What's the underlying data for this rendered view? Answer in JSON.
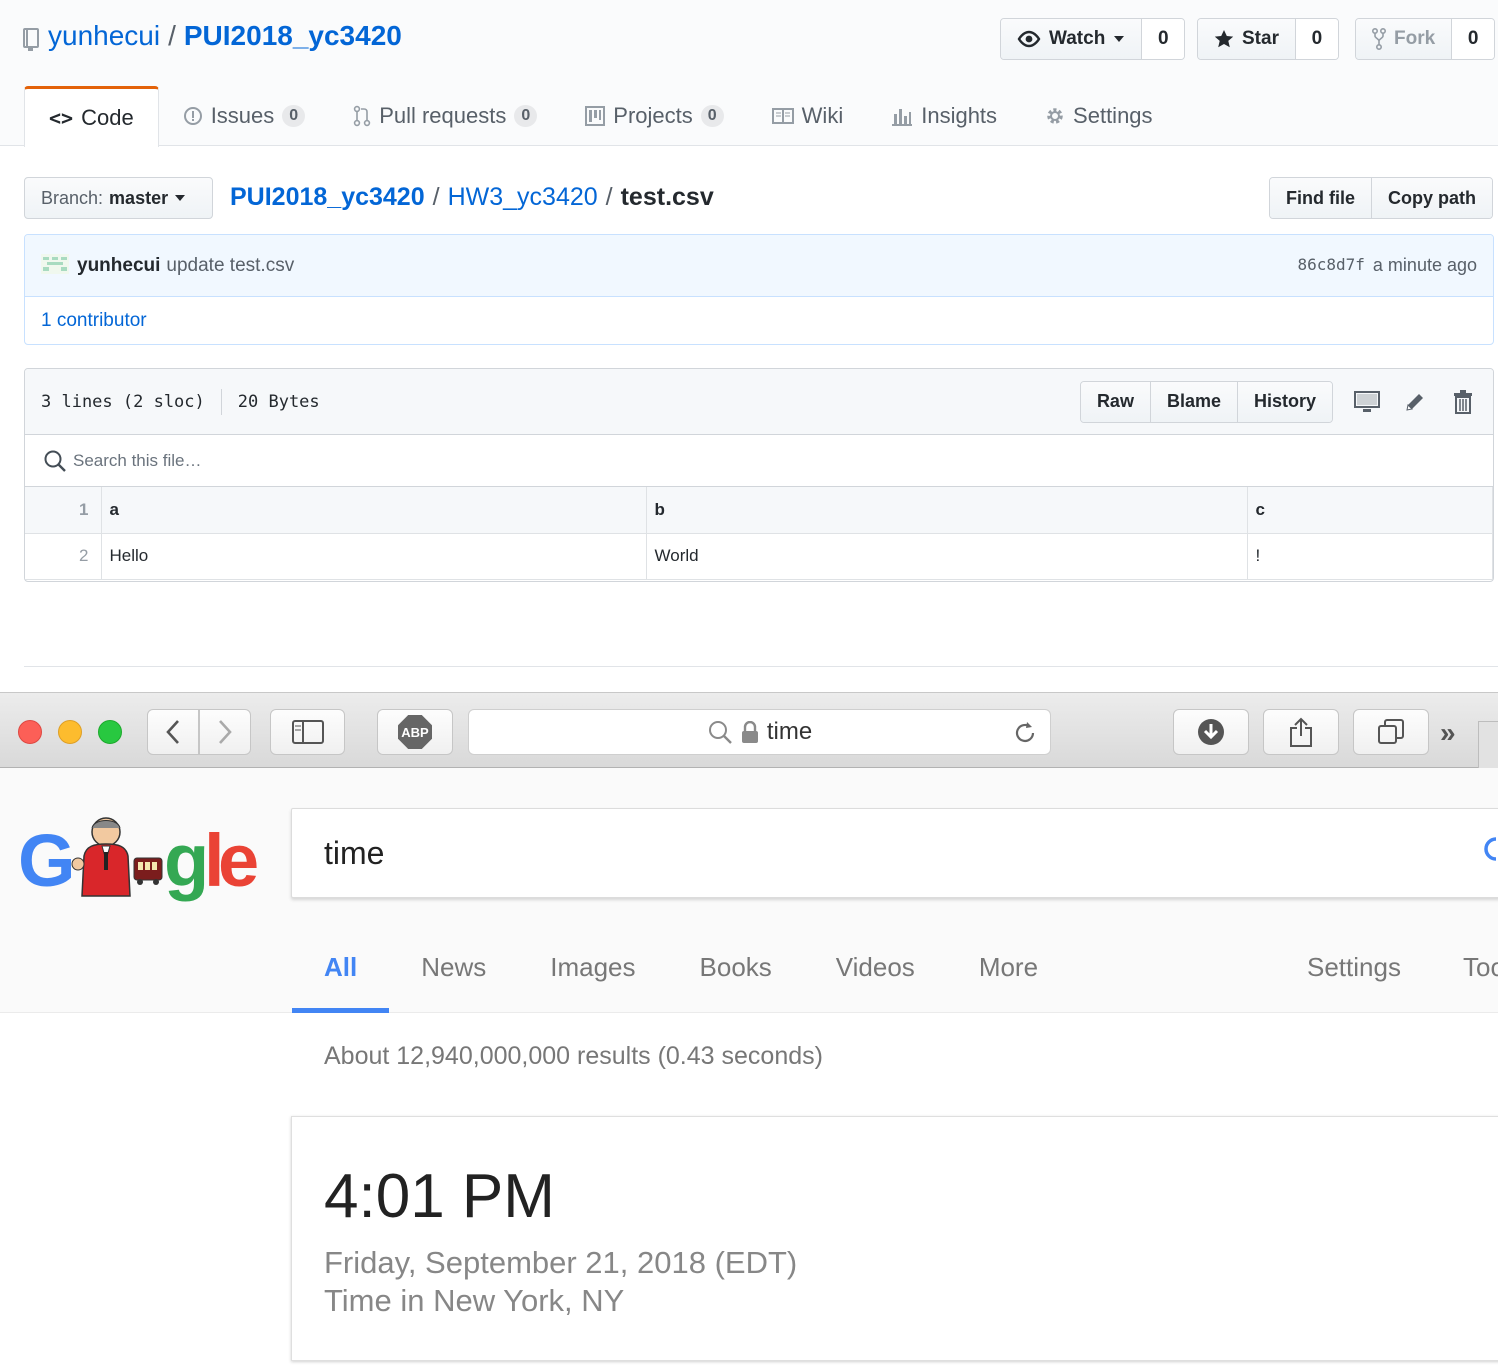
{
  "github": {
    "owner": "yunhecui",
    "slash": "/",
    "repo": "PUI2018_yc3420",
    "watch": {
      "label": "Watch",
      "count": "0"
    },
    "star": {
      "label": "Star",
      "count": "0"
    },
    "fork": {
      "label": "Fork",
      "count": "0"
    },
    "tabs": [
      {
        "label": "Code"
      },
      {
        "label": "Issues",
        "count": "0"
      },
      {
        "label": "Pull requests",
        "count": "0"
      },
      {
        "label": "Projects",
        "count": "0"
      },
      {
        "label": "Wiki"
      },
      {
        "label": "Insights"
      },
      {
        "label": "Settings"
      }
    ],
    "branch": {
      "prefix": "Branch:",
      "name": "master"
    },
    "breadcrumb": {
      "repo": "PUI2018_yc3420",
      "folder": "HW3_yc3420",
      "file": "test.csv"
    },
    "find_file": "Find file",
    "copy_path": "Copy path",
    "commit": {
      "author": "yunhecui",
      "message": "update test.csv",
      "sha": "86c8d7f",
      "time": "a minute ago",
      "contributors": "1 contributor"
    },
    "file": {
      "lines": "3 lines (2 sloc)",
      "size": "20 Bytes",
      "raw": "Raw",
      "blame": "Blame",
      "history": "History",
      "search_placeholder": "Search this file…",
      "rows": [
        {
          "num": "1",
          "cells": [
            "a",
            "b",
            "c"
          ]
        },
        {
          "num": "2",
          "cells": [
            "Hello",
            "World",
            "!"
          ]
        }
      ]
    }
  },
  "safari": {
    "url": "time",
    "abp": "ABP",
    "more": "»"
  },
  "google": {
    "query": "time",
    "tabs": [
      "All",
      "News",
      "Images",
      "Books",
      "Videos",
      "More"
    ],
    "settings": "Settings",
    "tools": "Tools",
    "stats": "About 12,940,000,000 results (0.43 seconds)",
    "time": "4:01 PM",
    "date": "Friday, September 21, 2018 (EDT)",
    "location": "Time in New York, NY"
  },
  "colors": {
    "link": "#0366d6",
    "active_tab_border": "#e36209",
    "google_blue": "#4285f4"
  }
}
